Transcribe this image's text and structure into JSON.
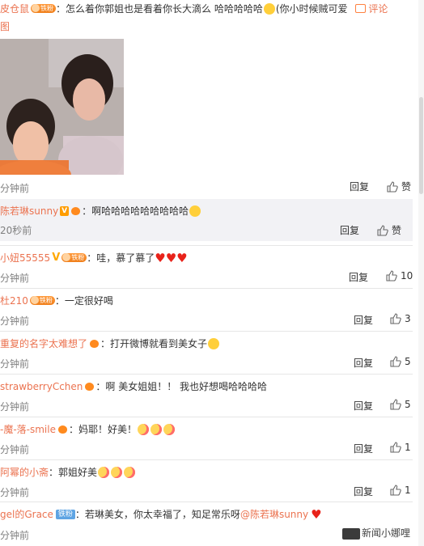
{
  "comments": [
    {
      "user": "皮仓鼠",
      "badge": "铁粉",
      "text": "：怎么着你郭姐也是看着你长大滴么 哈哈哈哈哈",
      "text_tail": "(你小时候贼可爱",
      "comment_label": "评论",
      "text_wrap": "图",
      "time": "分钟前",
      "reply": "回复",
      "like": "赞"
    },
    {
      "user": "陈若琳sunny",
      "text": "：啊哈哈哈哈哈哈哈哈哈",
      "time": "20秒前",
      "reply": "回复",
      "like": "赞"
    },
    {
      "user": "小妞55555",
      "badge": "铁粉",
      "text": "：哇，慕了慕了",
      "time": "分钟前",
      "reply": "回复",
      "like": "10"
    },
    {
      "user": "杜210",
      "badge": "铁粉",
      "text": "：一定很好喝",
      "time": "分钟前",
      "reply": "回复",
      "like": "3"
    },
    {
      "user": "重复的名字太难想了",
      "text": "：打开微博就看到美女子",
      "time": "分钟前",
      "reply": "回复",
      "like": "5"
    },
    {
      "user": "strawberryCchen",
      "text": "：啊 美女姐姐！！ 我也好想喝哈哈哈哈",
      "time": "分钟前",
      "reply": "回复",
      "like": "5"
    },
    {
      "user": "-魔-落-smile",
      "text": "：妈耶！好美！",
      "time": "分钟前",
      "reply": "回复",
      "like": "1"
    },
    {
      "user": "阿幂的小斋",
      "text": "：郭姐好美",
      "time": "分钟前",
      "reply": "回复",
      "like": "1"
    },
    {
      "user": "gel的Grace",
      "badge": "铁粉",
      "text": "：若琳美女，你太幸福了，知足常乐呀",
      "mention": "@陈若琳sunny",
      "time": "分钟前"
    }
  ],
  "watermark": "新闻小娜哩",
  "colors": {
    "username": "#eb7350",
    "divider": "#e6e6e6",
    "reply_bg": "#f2f2f5",
    "heart": "#e8221a"
  }
}
